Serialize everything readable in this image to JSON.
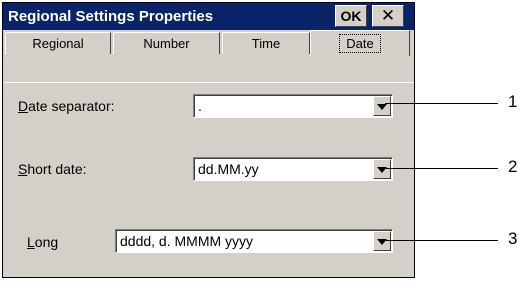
{
  "window": {
    "title": "Regional Settings Properties",
    "ok_label": "OK",
    "close_glyph": "✕"
  },
  "tabs": [
    {
      "label": "Regional",
      "selected": false
    },
    {
      "label": "Number",
      "selected": false
    },
    {
      "label": "Time",
      "selected": false
    },
    {
      "label": "Date",
      "selected": true
    }
  ],
  "fields": [
    {
      "label_mnemonic": "D",
      "label_rest": "ate separator:",
      "value": ".",
      "callout": "1"
    },
    {
      "label_mnemonic": "S",
      "label_rest": "hort date:",
      "value": "dd.MM.yy",
      "callout": "2"
    },
    {
      "label_mnemonic": "L",
      "label_rest": "ong",
      "value": "dddd, d. MMMM yyyy",
      "callout": "3"
    }
  ],
  "icons": {
    "dropdown": "chevron-down-icon",
    "close": "close-icon"
  },
  "colors": {
    "titlebar": "#0a246a",
    "face": "#d4d0c8"
  }
}
